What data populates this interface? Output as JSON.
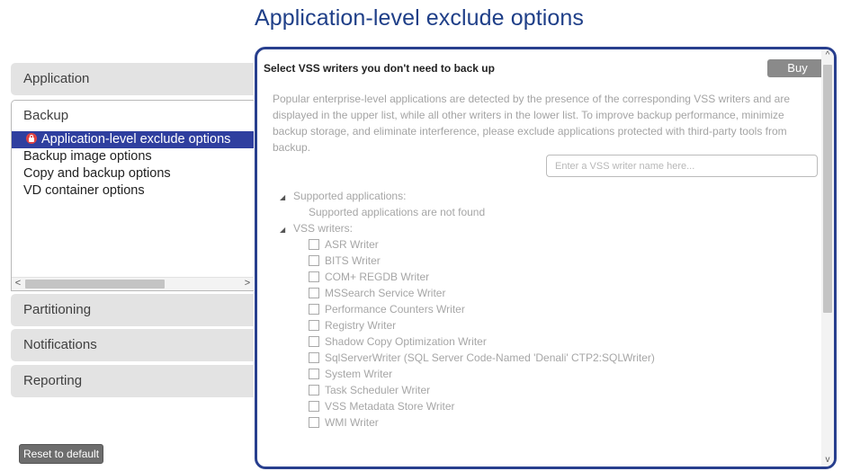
{
  "page": {
    "title": "Application-level exclude options"
  },
  "sidebar": {
    "categories": [
      {
        "label": "Application"
      },
      {
        "label": "Backup"
      },
      {
        "label": "Partitioning"
      },
      {
        "label": "Notifications"
      },
      {
        "label": "Reporting"
      }
    ],
    "backup_items": [
      {
        "label": "Application-level exclude options",
        "selected": true,
        "icon": "lock-icon"
      },
      {
        "label": "Backup image options"
      },
      {
        "label": "Copy and backup options"
      },
      {
        "label": "VD container options"
      }
    ],
    "scroll_left": "<",
    "scroll_right": ">",
    "reset_label": "Reset to default"
  },
  "panel": {
    "heading": "Select VSS writers you don't need to back up",
    "buy_label": "Buy",
    "description": "Popular enterprise-level applications are detected by the presence of the corresponding VSS writers and are displayed in the upper list, while all other writers in the lower list. To improve backup performance, minimize backup storage, and eliminate interference, please exclude applications protected with third-party tools from backup.",
    "search_placeholder": "Enter a VSS writer name here...",
    "supported_label": "Supported applications:",
    "supported_empty": "Supported applications are not found",
    "writers_label": "VSS writers:",
    "writers": [
      "ASR Writer",
      "BITS Writer",
      "COM+ REGDB Writer",
      "MSSearch Service Writer",
      "Performance Counters Writer",
      "Registry Writer",
      "Shadow Copy Optimization Writer",
      "SqlServerWriter (SQL Server Code-Named 'Denali' CTP2:SQLWriter)",
      "System Writer",
      "Task Scheduler Writer",
      "VSS Metadata Store Writer",
      "WMI Writer"
    ],
    "scroll_up": "^",
    "scroll_down": "v"
  },
  "colors": {
    "accent": "#283f8e",
    "selected": "#2f3f9f",
    "lock": "#e04343"
  }
}
